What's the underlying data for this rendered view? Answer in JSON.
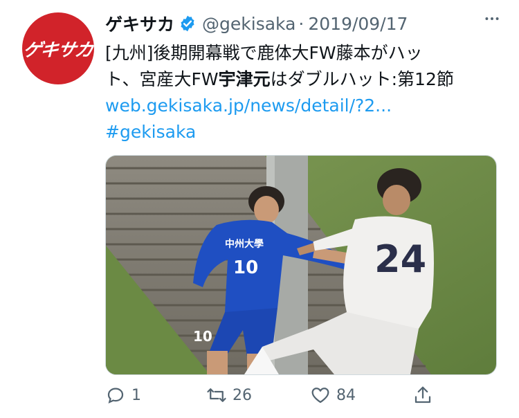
{
  "account": {
    "avatar_text": "ゲキサカ",
    "display_name": "ゲキサカ",
    "handle": "@gekisaka",
    "separator": "·",
    "date": "2019/09/17"
  },
  "tweet": {
    "line1": "[九州]後期開幕戦で鹿体大FW藤本がハッ",
    "line2_pre": "ト、宮産大FW",
    "line2_bold": "宇津元",
    "line2_post": "はダブルハット:第12節",
    "link": "web.gekisaka.jp/news/detail/?2...",
    "hashtag": "#gekisaka"
  },
  "media": {
    "description_icon": "photo",
    "player_left_number": "10",
    "player_left_shirt_text": "中州大學",
    "player_right_number": "24"
  },
  "actions": {
    "reply_count": "1",
    "retweet_count": "26",
    "like_count": "84"
  },
  "colors": {
    "brand_red": "#d1232a",
    "link_blue": "#1d9bf0",
    "muted": "#536471"
  }
}
